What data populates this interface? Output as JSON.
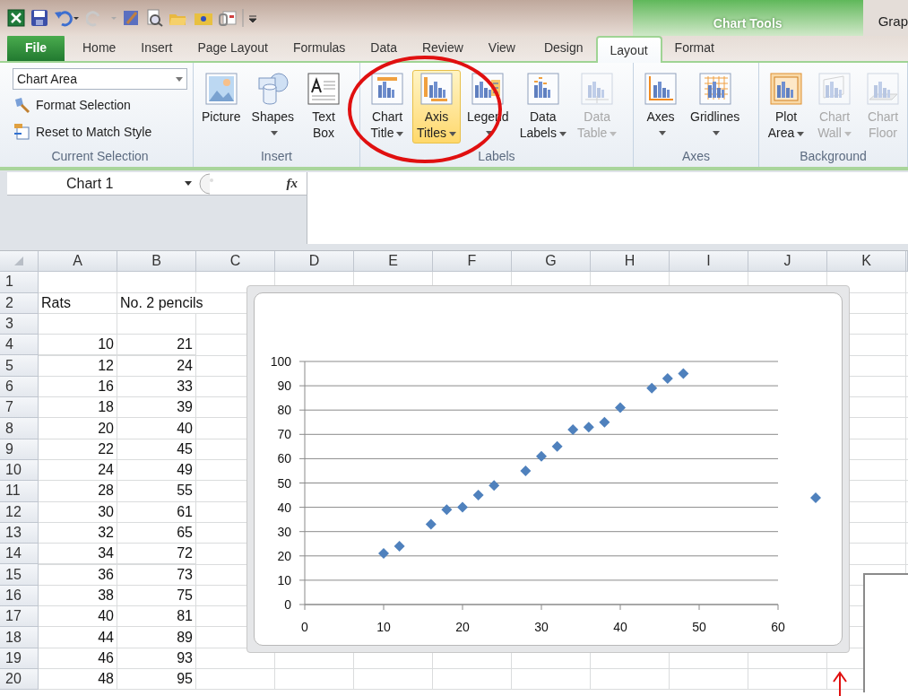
{
  "title_bar": {
    "contextual_header": "Chart Tools",
    "window_title": "Grap"
  },
  "tabs": [
    {
      "label": "File",
      "kind": "file",
      "selected": false
    },
    {
      "label": "Home",
      "kind": "normal",
      "selected": false
    },
    {
      "label": "Insert",
      "kind": "normal",
      "selected": false
    },
    {
      "label": "Page Layout",
      "kind": "normal",
      "selected": false
    },
    {
      "label": "Formulas",
      "kind": "normal",
      "selected": false
    },
    {
      "label": "Data",
      "kind": "normal",
      "selected": false
    },
    {
      "label": "Review",
      "kind": "normal",
      "selected": false
    },
    {
      "label": "View",
      "kind": "normal",
      "selected": false
    },
    {
      "label": "Design",
      "kind": "contextual",
      "selected": false
    },
    {
      "label": "Layout",
      "kind": "contextual",
      "selected": true
    },
    {
      "label": "Format",
      "kind": "contextual",
      "selected": false
    }
  ],
  "ribbon": {
    "groups": [
      {
        "name": "Current Selection",
        "kind": "selection",
        "dropdown": "Chart Area",
        "commands": [
          {
            "label": "Format Selection"
          },
          {
            "label": "Reset to Match Style"
          }
        ]
      },
      {
        "name": "Insert",
        "kind": "buttons",
        "buttons": [
          {
            "lines": [
              "Picture"
            ],
            "caret": false,
            "disabled": false,
            "highlighted": false
          },
          {
            "lines": [
              "Shapes"
            ],
            "caret": true,
            "disabled": false,
            "highlighted": false
          },
          {
            "lines": [
              "Text",
              "Box"
            ],
            "caret": false,
            "disabled": false,
            "highlighted": false
          }
        ]
      },
      {
        "name": "Labels",
        "kind": "buttons",
        "buttons": [
          {
            "lines": [
              "Chart",
              "Title"
            ],
            "caret": true,
            "disabled": false,
            "highlighted": false
          },
          {
            "lines": [
              "Axis",
              "Titles"
            ],
            "caret": true,
            "disabled": false,
            "highlighted": true
          },
          {
            "lines": [
              "Legend"
            ],
            "caret": true,
            "disabled": false,
            "highlighted": false
          },
          {
            "lines": [
              "Data",
              "Labels"
            ],
            "caret": true,
            "disabled": false,
            "highlighted": false
          },
          {
            "lines": [
              "Data",
              "Table"
            ],
            "caret": true,
            "disabled": true,
            "highlighted": false
          }
        ]
      },
      {
        "name": "Axes",
        "kind": "buttons",
        "buttons": [
          {
            "lines": [
              "Axes"
            ],
            "caret": true,
            "disabled": false,
            "highlighted": false
          },
          {
            "lines": [
              "Gridlines"
            ],
            "caret": true,
            "disabled": false,
            "highlighted": false
          }
        ]
      },
      {
        "name": "Background",
        "kind": "buttons",
        "buttons": [
          {
            "lines": [
              "Plot",
              "Area"
            ],
            "caret": true,
            "disabled": false,
            "highlighted": false
          },
          {
            "lines": [
              "Chart",
              "Wall"
            ],
            "caret": true,
            "disabled": true,
            "highlighted": false
          },
          {
            "lines": [
              "Chart",
              "Floor"
            ],
            "caret": false,
            "disabled": true,
            "highlighted": false
          }
        ]
      }
    ]
  },
  "formula_bar": {
    "name_box": "Chart 1",
    "function_label": "fx"
  },
  "sheet": {
    "columns": [
      "A",
      "B",
      "C",
      "D",
      "E",
      "F",
      "G",
      "H",
      "I",
      "J",
      "K"
    ],
    "rows": [
      {
        "number": "1"
      },
      {
        "number": "2",
        "cells": [
          {
            "text": "Rats",
            "kind": "text"
          },
          {
            "text": "No. 2 pencils",
            "kind": "text"
          }
        ]
      },
      {
        "number": "3"
      },
      {
        "number": "4",
        "cells": [
          {
            "text": "10",
            "kind": "number"
          },
          {
            "text": "21",
            "kind": "number"
          }
        ]
      },
      {
        "number": "5",
        "cells": [
          {
            "text": "12",
            "kind": "number"
          },
          {
            "text": "24",
            "kind": "number"
          }
        ]
      },
      {
        "number": "6",
        "cells": [
          {
            "text": "16",
            "kind": "number"
          },
          {
            "text": "33",
            "kind": "number"
          }
        ]
      },
      {
        "number": "7",
        "cells": [
          {
            "text": "18",
            "kind": "number"
          },
          {
            "text": "39",
            "kind": "number"
          }
        ]
      },
      {
        "number": "8",
        "cells": [
          {
            "text": "20",
            "kind": "number"
          },
          {
            "text": "40",
            "kind": "number"
          }
        ]
      },
      {
        "number": "9",
        "cells": [
          {
            "text": "22",
            "kind": "number"
          },
          {
            "text": "45",
            "kind": "number"
          }
        ]
      },
      {
        "number": "10",
        "cells": [
          {
            "text": "24",
            "kind": "number"
          },
          {
            "text": "49",
            "kind": "number"
          }
        ]
      },
      {
        "number": "11",
        "cells": [
          {
            "text": "28",
            "kind": "number"
          },
          {
            "text": "55",
            "kind": "number"
          }
        ]
      },
      {
        "number": "12",
        "cells": [
          {
            "text": "30",
            "kind": "number"
          },
          {
            "text": "61",
            "kind": "number"
          }
        ]
      },
      {
        "number": "13",
        "cells": [
          {
            "text": "32",
            "kind": "number"
          },
          {
            "text": "65",
            "kind": "number"
          }
        ]
      },
      {
        "number": "14",
        "cells": [
          {
            "text": "34",
            "kind": "number"
          },
          {
            "text": "72",
            "kind": "number"
          }
        ]
      },
      {
        "number": "15",
        "cells": [
          {
            "text": "36",
            "kind": "number"
          },
          {
            "text": "73",
            "kind": "number"
          }
        ]
      },
      {
        "number": "16",
        "cells": [
          {
            "text": "38",
            "kind": "number"
          },
          {
            "text": "75",
            "kind": "number"
          }
        ]
      },
      {
        "number": "17",
        "cells": [
          {
            "text": "40",
            "kind": "number"
          },
          {
            "text": "81",
            "kind": "number"
          }
        ]
      },
      {
        "number": "18",
        "cells": [
          {
            "text": "44",
            "kind": "number"
          },
          {
            "text": "89",
            "kind": "number"
          }
        ]
      },
      {
        "number": "19",
        "cells": [
          {
            "text": "46",
            "kind": "number"
          },
          {
            "text": "93",
            "kind": "number"
          }
        ]
      },
      {
        "number": "20",
        "cells": [
          {
            "text": "48",
            "kind": "number"
          },
          {
            "text": "95",
            "kind": "number"
          }
        ]
      }
    ]
  },
  "chart": {
    "chart_data": {
      "type": "scatter",
      "x": [
        10,
        12,
        16,
        18,
        20,
        22,
        24,
        28,
        30,
        32,
        34,
        36,
        38,
        40,
        44,
        46,
        48
      ],
      "series": [
        {
          "color": "#4f81bd",
          "values": [
            21,
            24,
            33,
            39,
            40,
            45,
            49,
            55,
            61,
            65,
            72,
            73,
            75,
            81,
            89,
            93,
            95
          ]
        }
      ],
      "xlim": [
        0,
        60
      ],
      "ylim": [
        0,
        100
      ],
      "grid": true,
      "xticks": [
        0,
        10,
        20,
        30,
        40,
        50,
        60
      ],
      "yticks": [
        0,
        10,
        20,
        30,
        40,
        50,
        60,
        70,
        80,
        90,
        100
      ]
    },
    "stray_marker": true
  }
}
